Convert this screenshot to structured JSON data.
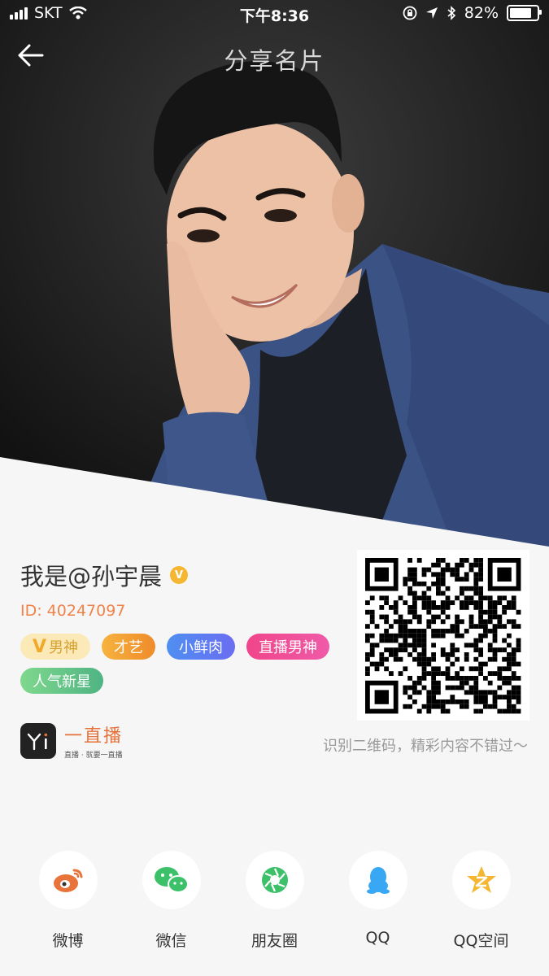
{
  "status": {
    "carrier": "SKT",
    "time": "下午8:36",
    "battery": "82%"
  },
  "nav": {
    "title": "分享名片"
  },
  "profile": {
    "name": "我是@孙宇晨",
    "verified_mark": "V",
    "id": "ID: 40247097"
  },
  "tags": [
    {
      "label": "男神",
      "mark": "V"
    },
    {
      "label": "才艺"
    },
    {
      "label": "小鲜肉"
    },
    {
      "label": "直播男神"
    },
    {
      "label": "人气新星"
    }
  ],
  "brand": {
    "name": "一直播",
    "slogan": "直播 · 就要一直播"
  },
  "qr_tip": "识别二维码，精彩内容不错过～",
  "share": [
    {
      "label": "微博",
      "icon": "weibo-icon"
    },
    {
      "label": "微信",
      "icon": "wechat-icon"
    },
    {
      "label": "朋友圈",
      "icon": "moments-icon"
    },
    {
      "label": "QQ",
      "icon": "qq-icon"
    },
    {
      "label": "QQ空间",
      "icon": "qzone-icon"
    }
  ],
  "colors": {
    "accent": "#f0834a",
    "verified": "#f5b731",
    "weibo": "#e8743b",
    "wechat": "#3cc06a",
    "qq": "#38a8f4",
    "qzone": "#f5b731"
  }
}
